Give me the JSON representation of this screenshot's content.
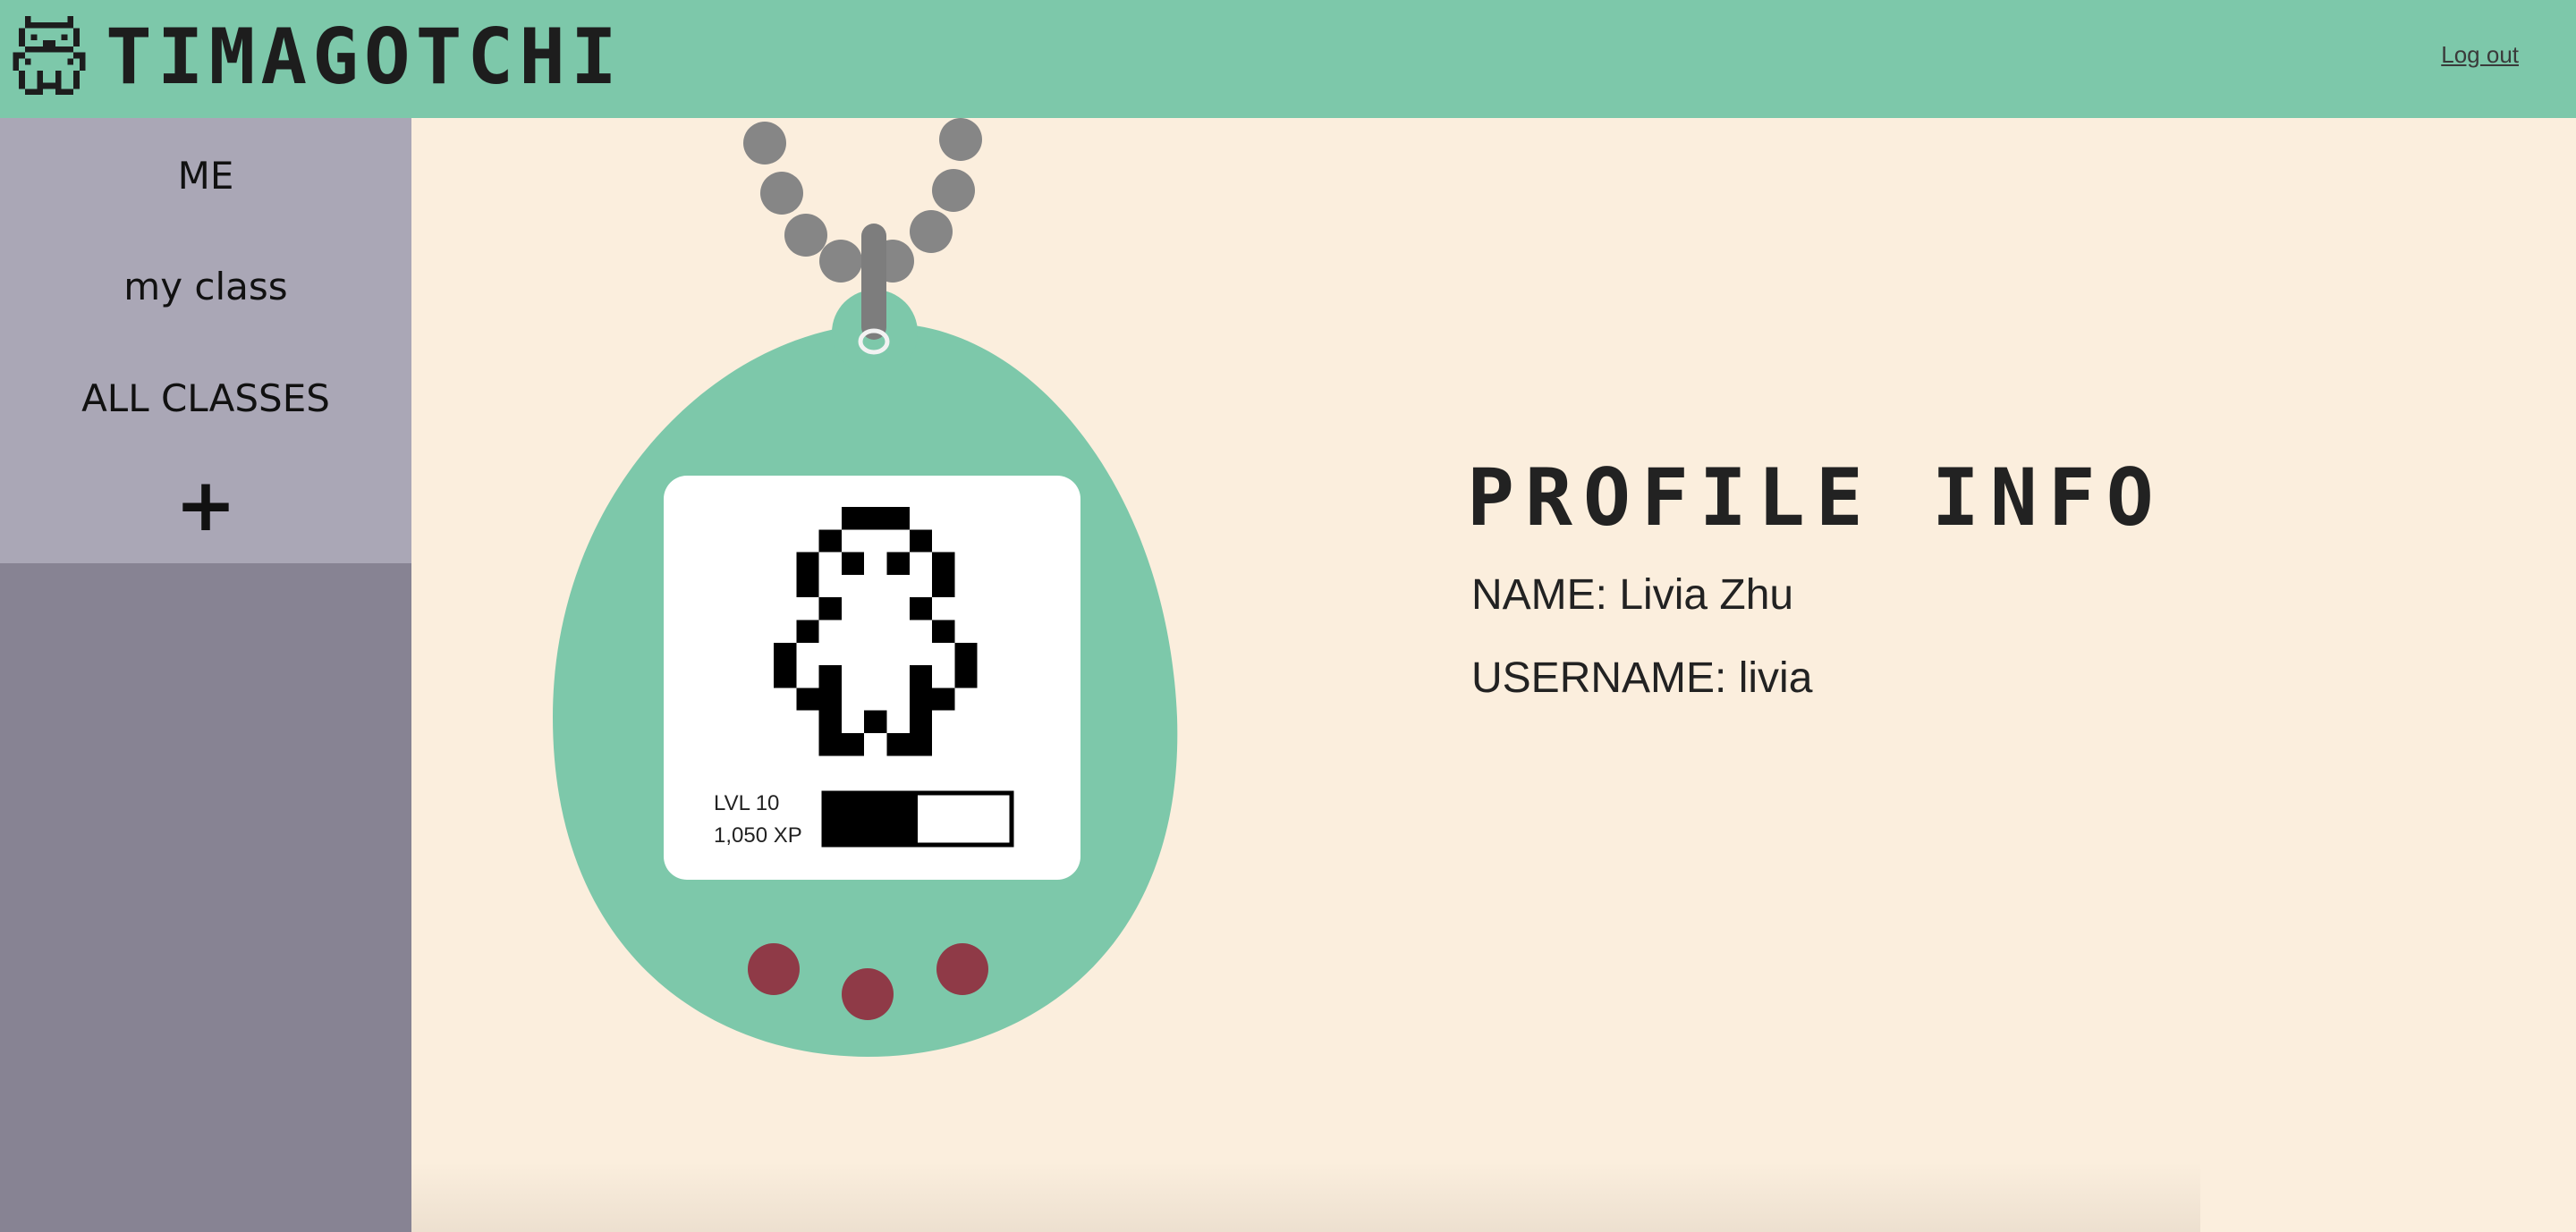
{
  "header": {
    "app_title": "TIMAGOTCHI",
    "logout_label": "Log out",
    "logo_icon": "pixel-creature-icon"
  },
  "sidebar": {
    "items": [
      {
        "label": "ME"
      },
      {
        "label": "my class"
      },
      {
        "label": "ALL CLASSES"
      },
      {
        "label": "+"
      }
    ]
  },
  "pet": {
    "level_label": "LVL 10",
    "xp_label": "1,050 XP",
    "xp_progress": 0.5
  },
  "profile": {
    "title": "PROFILE INFO",
    "name_line": "NAME: Livia Zhu",
    "username_line": "USERNAME: livia"
  },
  "colors": {
    "header_bg": "#7dc8aa",
    "page_bg": "#fbeedd",
    "sidebar_light": "#aaa7b6",
    "sidebar_dark": "#878393",
    "device_body": "#7dc8aa",
    "device_button": "#8f3a47",
    "chain": "#868686"
  }
}
